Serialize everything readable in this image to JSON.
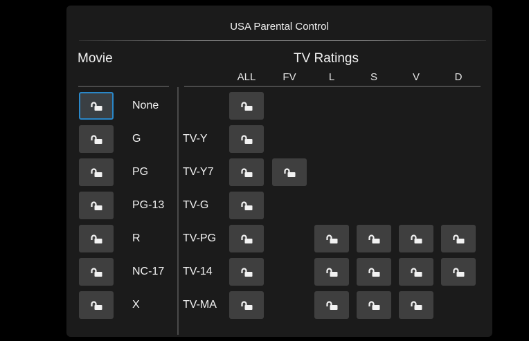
{
  "title": "USA Parental Control",
  "movie": {
    "heading": "Movie",
    "ratings": [
      "None",
      "G",
      "PG",
      "PG-13",
      "R",
      "NC-17",
      "X"
    ],
    "selected_index": 0
  },
  "tv": {
    "heading": "TV Ratings",
    "columns": [
      "ALL",
      "FV",
      "L",
      "S",
      "V",
      "D"
    ],
    "rows": [
      {
        "label": "",
        "cells": [
          true,
          false,
          false,
          false,
          false,
          false
        ]
      },
      {
        "label": "TV-Y",
        "cells": [
          true,
          false,
          false,
          false,
          false,
          false
        ]
      },
      {
        "label": "TV-Y7",
        "cells": [
          true,
          true,
          false,
          false,
          false,
          false
        ]
      },
      {
        "label": "TV-G",
        "cells": [
          true,
          false,
          false,
          false,
          false,
          false
        ]
      },
      {
        "label": "TV-PG",
        "cells": [
          true,
          false,
          true,
          true,
          true,
          true
        ]
      },
      {
        "label": "TV-14",
        "cells": [
          true,
          false,
          true,
          true,
          true,
          true
        ]
      },
      {
        "label": "TV-MA",
        "cells": [
          true,
          false,
          true,
          true,
          true,
          false
        ]
      }
    ]
  },
  "icons": {
    "lock": "unlocked-padlock-icon"
  },
  "colors": {
    "panel": "#1b1b1b",
    "button": "#3f3f3f",
    "focus": "#2a87c8",
    "text": "#f2f2f2"
  }
}
